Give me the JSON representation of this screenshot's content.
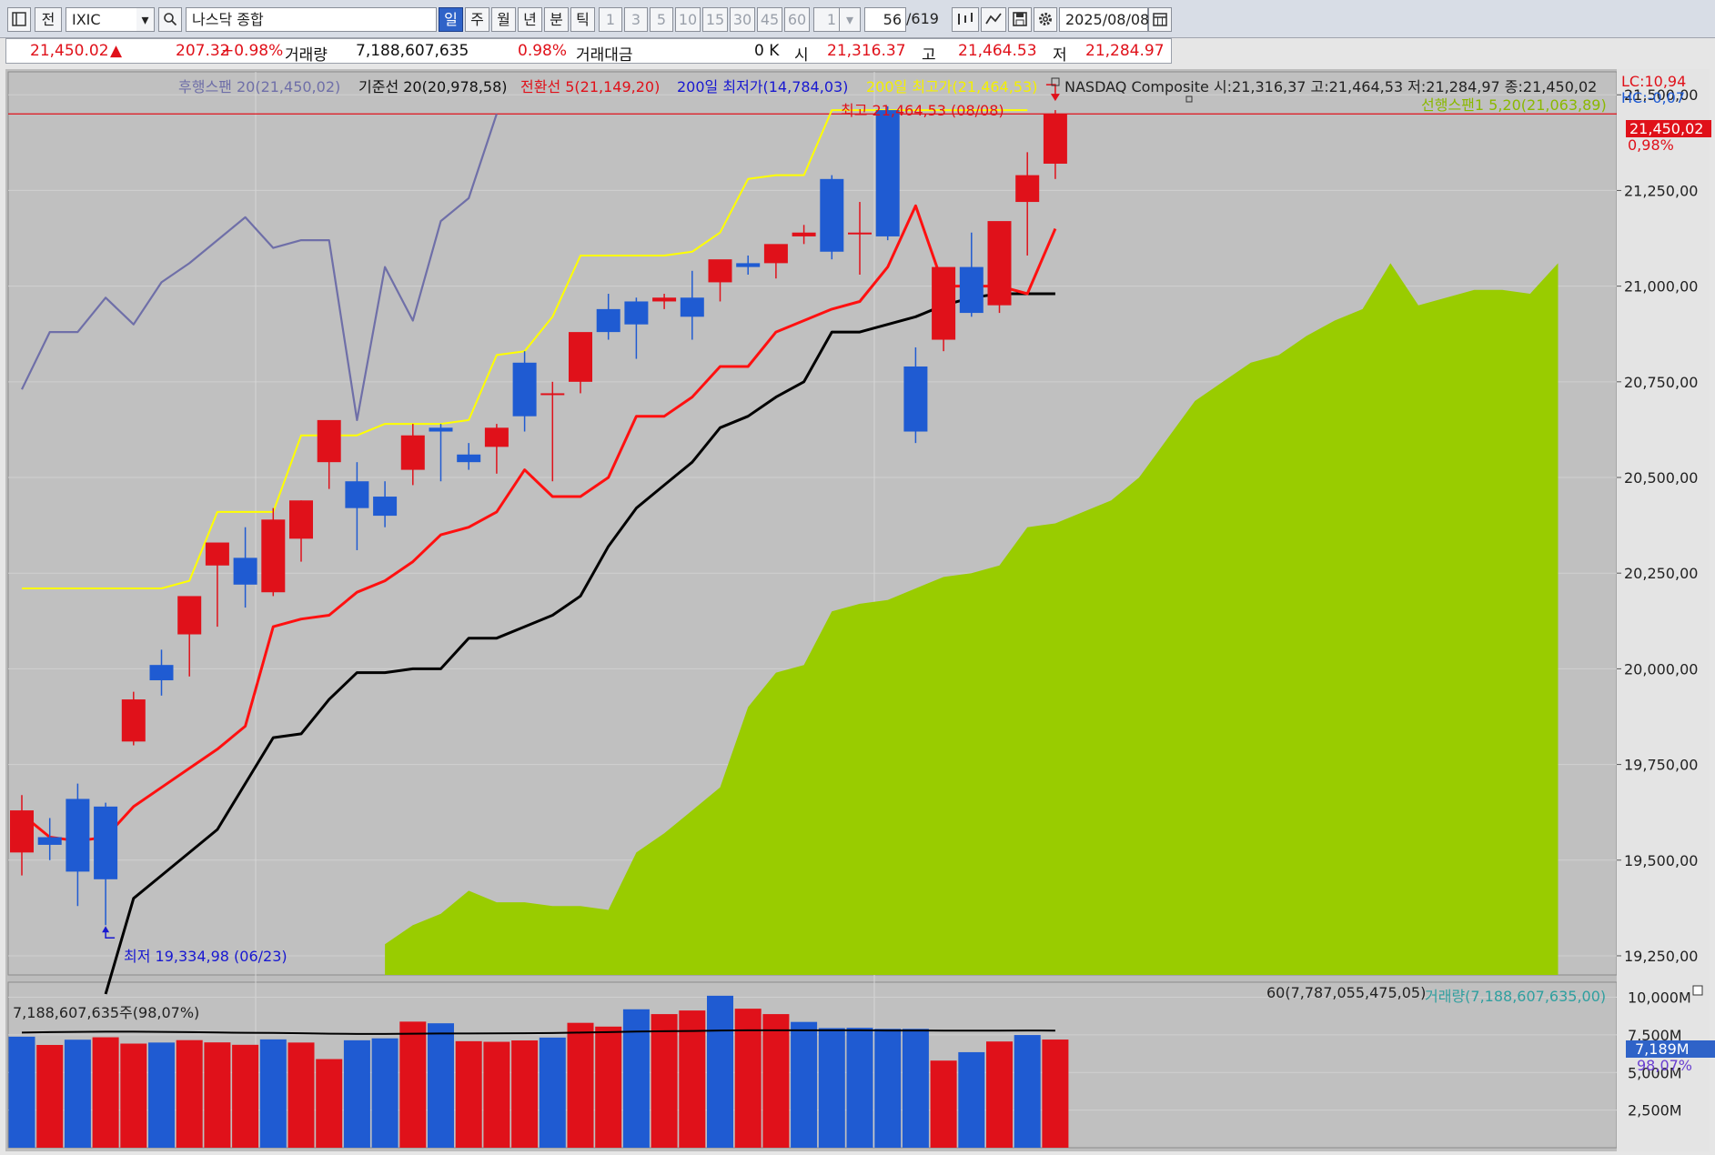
{
  "toolbar": {
    "prev_label": "전",
    "code": "IXIC",
    "name": "나스닥 종합",
    "periods": [
      "일",
      "주",
      "월",
      "년",
      "분",
      "틱"
    ],
    "minutes": [
      "1",
      "3",
      "5",
      "10",
      "15",
      "30",
      "45",
      "60"
    ],
    "count_value": "1",
    "range_current": "56",
    "range_total": "/619",
    "date": "2025/08/08"
  },
  "quote": {
    "price": "21,450.02",
    "arrow": "▲",
    "change": "207.32",
    "change_pct": "+0.98%",
    "volume_label": "거래량",
    "volume": "7,188,607,635",
    "volume_pct": "0.98%",
    "amount_label": "거래대금",
    "amount": "0 K",
    "open_label": "시",
    "open": "21,316.37",
    "high_label": "고",
    "high": "21,464.53",
    "low_label": "저",
    "low": "21,284.97"
  },
  "legend": {
    "lagging": "후행스팬 20(21,450,02)",
    "base": "기준선 20(20,978,58)",
    "conversion": "전환선 5(21,149,20)",
    "low200": "200일 최저가(14,784,03)",
    "high200": "200일 최고가(21,464,53)",
    "summary": "NASDAQ Composite 시:21,316,37 고:21,464,53 저:21,284,97 종:21,450,02",
    "lc": "LC:10,94",
    "hc": "HC:-0,07",
    "span1": "선행스팬1 5,20(21,063,89)"
  },
  "annotations": {
    "high": "최고 21,464,53 (08/08)",
    "low": "최저 19,334,98 (06/23)",
    "last_price": "21,450,02",
    "last_pct": "0,98%"
  },
  "volume_legend": {
    "left": "7,188,607,635주(98,07%)",
    "ma": "60(7,787,055,475,05)",
    "vol": "거래량(7,188,607,635,00)",
    "tag": "7,189M",
    "tag_pct": "98,07%"
  },
  "colors": {
    "up": "#e0111a",
    "down": "#1f5bd2",
    "conversion": "#ff1010",
    "base": "#000000",
    "lagging": "#6f6fa8",
    "high200": "#ffff00",
    "cloud": "#99cc00",
    "bg": "#c0c0c0"
  },
  "chart_data": [
    {
      "type": "candlestick",
      "title": "NASDAQ Composite",
      "ylim": [
        19200,
        21560
      ],
      "yticks": [
        "21,500,00",
        "21,250,00",
        "21,000,00",
        "20,750,00",
        "20,500,00",
        "20,250,00",
        "20,000,00",
        "19,750,00",
        "19,500,00",
        "19,250,00"
      ],
      "ytick_values": [
        21500,
        21250,
        21000,
        20750,
        20500,
        20250,
        20000,
        19750,
        19500,
        19250
      ],
      "ohlc": [
        [
          19520,
          19670,
          19460,
          19630
        ],
        [
          19560,
          19610,
          19500,
          19540
        ],
        [
          19660,
          19700,
          19380,
          19470
        ],
        [
          19640,
          19650,
          19330,
          19450
        ],
        [
          19810,
          19940,
          19800,
          19920
        ],
        [
          20010,
          20050,
          19930,
          19970
        ],
        [
          20090,
          20180,
          19980,
          20190
        ],
        [
          20270,
          20320,
          20110,
          20330
        ],
        [
          20290,
          20370,
          20160,
          20220
        ],
        [
          20200,
          20420,
          20190,
          20390
        ],
        [
          20340,
          20440,
          20280,
          20440
        ],
        [
          20540,
          20640,
          20470,
          20650
        ],
        [
          20490,
          20540,
          20310,
          20420
        ],
        [
          20450,
          20490,
          20370,
          20400
        ],
        [
          20520,
          20640,
          20480,
          20610
        ],
        [
          20630,
          20640,
          20490,
          20620
        ],
        [
          20560,
          20590,
          20520,
          20540
        ],
        [
          20580,
          20640,
          20510,
          20630
        ],
        [
          20800,
          20830,
          20620,
          20660
        ],
        [
          20720,
          20750,
          20490,
          20720
        ],
        [
          20750,
          20850,
          20720,
          20880
        ],
        [
          20940,
          20980,
          20860,
          20880
        ],
        [
          20960,
          20970,
          20810,
          20900
        ],
        [
          20960,
          20980,
          20940,
          20970
        ],
        [
          20970,
          21040,
          20860,
          20920
        ],
        [
          21010,
          21040,
          20960,
          21070
        ],
        [
          21060,
          21080,
          21030,
          21050
        ],
        [
          21060,
          21090,
          21020,
          21110
        ],
        [
          21130,
          21160,
          21110,
          21140
        ],
        [
          21280,
          21290,
          21070,
          21090
        ],
        [
          21140,
          21220,
          21030,
          21140
        ],
        [
          21460,
          21470,
          21120,
          21130
        ],
        [
          20790,
          20840,
          20590,
          20620
        ],
        [
          20860,
          20890,
          20830,
          21050
        ],
        [
          21050,
          21140,
          20920,
          20930
        ],
        [
          20950,
          20980,
          20930,
          21170
        ],
        [
          21220,
          21350,
          21080,
          21290
        ],
        [
          21320,
          21460,
          21280,
          21450
        ]
      ],
      "conversion_line": [
        19620,
        19560,
        19550,
        19560,
        19640,
        19690,
        19740,
        19790,
        19850,
        20110,
        20130,
        20140,
        20200,
        20230,
        20280,
        20350,
        20370,
        20410,
        20520,
        20450,
        20450,
        20500,
        20660,
        20660,
        20710,
        20790,
        20790,
        20880,
        20910,
        20940,
        20960,
        21050,
        21210,
        21000,
        21000,
        21000,
        20980,
        21150
      ],
      "base_line": [
        19150,
        19400,
        19460,
        19520,
        19580,
        19700,
        19820,
        19830,
        19920,
        19990,
        19990,
        20000,
        20000,
        20080,
        20080,
        20110,
        20140,
        20190,
        20320,
        20420,
        20480,
        20540,
        20630,
        20660,
        20710,
        20750,
        20880,
        20880,
        20900,
        20920,
        20950,
        20970,
        20980,
        20980,
        20980
      ],
      "base_line_start": 3,
      "lagging_span": [
        20730,
        20880,
        20880,
        20970,
        20900,
        21010,
        21060,
        21120,
        21180,
        21100,
        21120,
        21120,
        20650,
        21050,
        20910,
        21170,
        21230,
        21450
      ],
      "high200_line": [
        20210,
        20210,
        20210,
        20210,
        20210,
        20210,
        20230,
        20410,
        20410,
        20410,
        20610,
        20610,
        20610,
        20640,
        20640,
        20640,
        20650,
        20820,
        20830,
        20920,
        21080,
        21080,
        21080,
        21080,
        21090,
        21140,
        21280,
        21290,
        21290,
        21460,
        21460,
        21460,
        21460,
        21460,
        21460,
        21460,
        21460
      ],
      "high200_start": 0,
      "cloud_top": [
        19280,
        19330,
        19360,
        19420,
        19390,
        19390,
        19380,
        19380,
        19370,
        19520,
        19570,
        19630,
        19690,
        19900,
        19990,
        20010,
        20150,
        20170,
        20180,
        20210,
        20240,
        20250,
        20270,
        20370,
        20380,
        20410,
        20440,
        20500,
        20600,
        20700,
        20750,
        20800,
        20820,
        20870,
        20910,
        20940,
        21060,
        20950,
        20970,
        20990,
        20990,
        20980,
        21060
      ],
      "cloud_start": 13
    },
    {
      "type": "bar",
      "title": "거래량",
      "unit": "M",
      "ylim": [
        0,
        11000
      ],
      "yticks": [
        "10,000M",
        "7,500M",
        "5,000M",
        "2,500M"
      ],
      "ytick_values": [
        10000,
        7500,
        5000,
        2500
      ],
      "values": [
        7380,
        6830,
        7180,
        7340,
        6920,
        6990,
        7150,
        7000,
        6840,
        7200,
        6990,
        5890,
        7140,
        7270,
        8380,
        8270,
        7080,
        7040,
        7130,
        7320,
        8300,
        8050,
        9200,
        8880,
        9120,
        10100,
        9240,
        8880,
        8360,
        7950,
        7970,
        7900,
        7900,
        5790,
        6350,
        7060,
        7490,
        7189
      ],
      "direction": [
        "down",
        "up",
        "down",
        "up",
        "up",
        "down",
        "up",
        "up",
        "up",
        "down",
        "up",
        "up",
        "down",
        "down",
        "up",
        "down",
        "up",
        "up",
        "up",
        "down",
        "up",
        "up",
        "down",
        "up",
        "up",
        "down",
        "up",
        "up",
        "down",
        "down",
        "down",
        "down",
        "down",
        "up",
        "down",
        "up",
        "down",
        "up"
      ],
      "ma60": [
        7650,
        7680,
        7700,
        7710,
        7710,
        7700,
        7680,
        7660,
        7640,
        7630,
        7610,
        7580,
        7560,
        7560,
        7580,
        7590,
        7590,
        7600,
        7610,
        7620,
        7650,
        7680,
        7720,
        7740,
        7760,
        7790,
        7800,
        7800,
        7800,
        7800,
        7800,
        7790,
        7790,
        7780,
        7780,
        7780,
        7790,
        7787
      ]
    }
  ]
}
